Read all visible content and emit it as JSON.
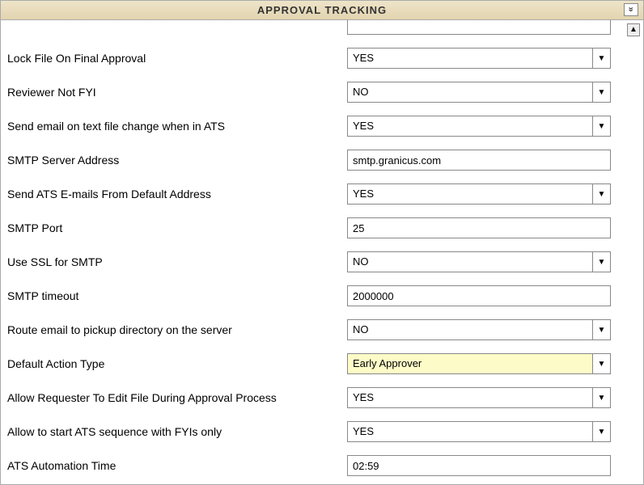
{
  "header": {
    "title": "APPROVAL TRACKING"
  },
  "fields": {
    "lockFile": {
      "label": "Lock File On Final Approval",
      "value": "YES"
    },
    "reviewerNotFyi": {
      "label": "Reviewer Not FYI",
      "value": "NO"
    },
    "sendEmailTextChange": {
      "label": "Send email on text file change when in ATS",
      "value": "YES"
    },
    "smtpServer": {
      "label": "SMTP Server Address",
      "value": "smtp.granicus.com"
    },
    "sendFromDefault": {
      "label": "Send ATS E-mails From Default Address",
      "value": "YES"
    },
    "smtpPort": {
      "label": "SMTP Port",
      "value": "25"
    },
    "useSsl": {
      "label": "Use SSL for SMTP",
      "value": "NO"
    },
    "smtpTimeout": {
      "label": "SMTP timeout",
      "value": "2000000"
    },
    "routePickup": {
      "label": "Route email to pickup directory on the server",
      "value": "NO"
    },
    "defaultAction": {
      "label": "Default Action Type",
      "value": "Early Approver"
    },
    "allowRequesterEdit": {
      "label": "Allow Requester To Edit File During Approval Process",
      "value": "YES"
    },
    "allowStartFyi": {
      "label": "Allow to start ATS sequence with FYIs only",
      "value": "YES"
    },
    "automationTime": {
      "label": "ATS Automation Time",
      "value": "02:59"
    }
  }
}
